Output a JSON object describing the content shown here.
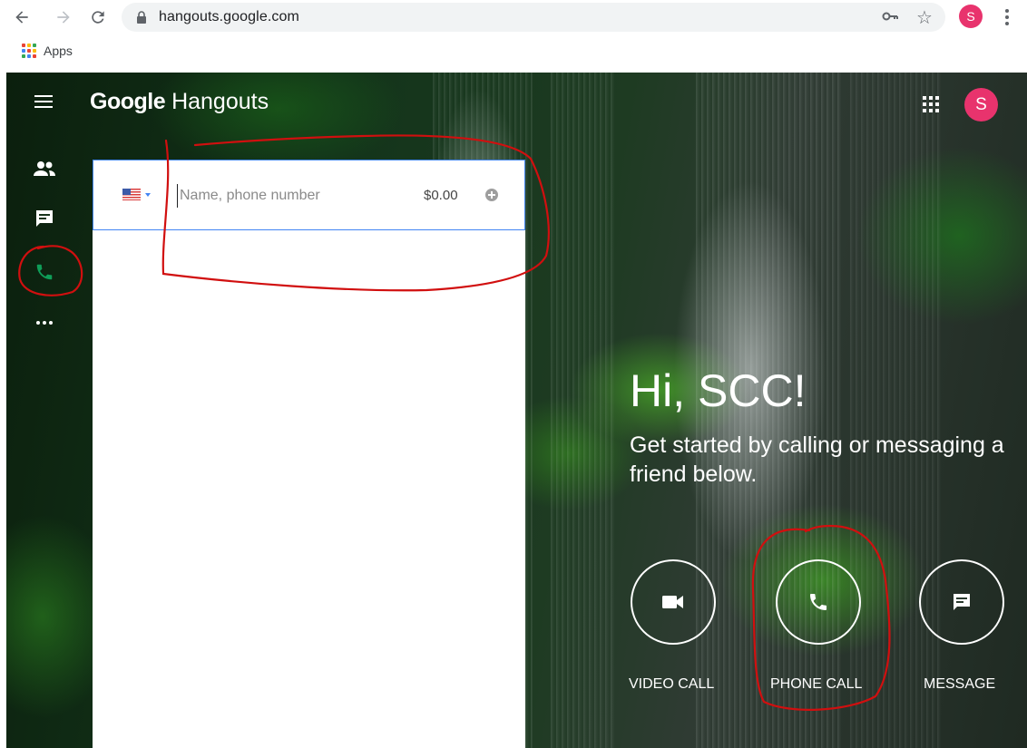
{
  "browser": {
    "url": "hangouts.google.com",
    "profile_initial": "S",
    "bookmarks": {
      "apps_label": "Apps"
    }
  },
  "app": {
    "logo_google": "Google",
    "logo_product": "Hangouts",
    "avatar_initial": "S",
    "rail": [
      "people-icon",
      "chat-icon",
      "phone-icon",
      "more-icon"
    ]
  },
  "dialer": {
    "placeholder": "Name, phone number",
    "credit": "$0.00",
    "country": "us-flag-icon"
  },
  "welcome": {
    "greeting": "Hi, SCC!",
    "subtext": "Get started by calling or messaging a friend below."
  },
  "actions": [
    {
      "label": "VIDEO CALL",
      "icon": "videocam-icon"
    },
    {
      "label": "PHONE CALL",
      "icon": "phone-icon"
    },
    {
      "label": "MESSAGE",
      "icon": "message-icon"
    }
  ],
  "colors": {
    "accent": "#e8336d",
    "call_green": "#0f9d58",
    "focus_blue": "#4285f4",
    "annotation_red": "#d10f0f"
  }
}
